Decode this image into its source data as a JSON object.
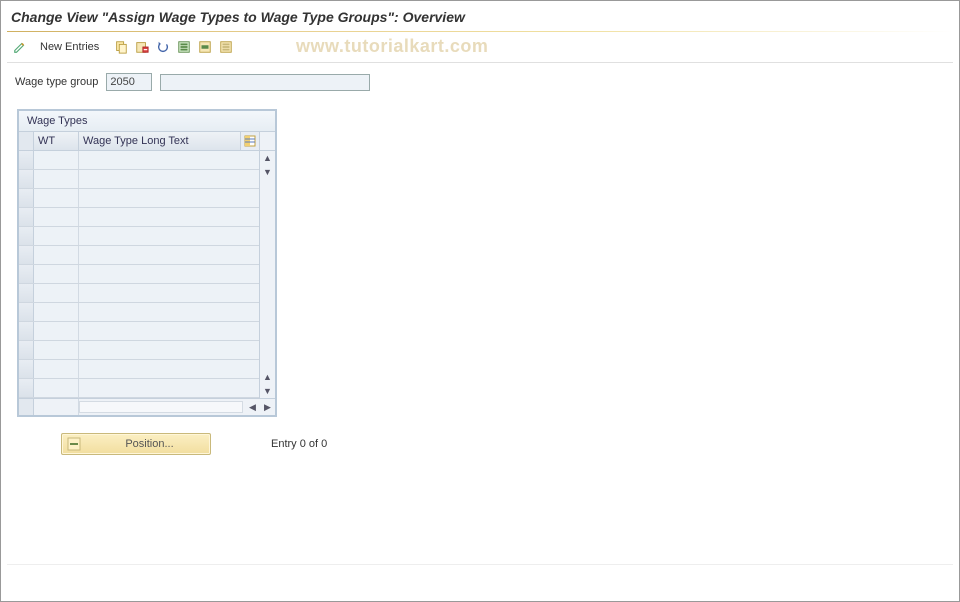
{
  "header": {
    "title": "Change View \"Assign Wage Types to Wage Type Groups\": Overview"
  },
  "toolbar": {
    "new_entries_label": "New Entries"
  },
  "watermark": "www.tutorialkart.com",
  "filter": {
    "label": "Wage type group",
    "value": "2050",
    "description": ""
  },
  "table": {
    "title": "Wage Types",
    "columns": {
      "wt": "WT",
      "long_text": "Wage Type Long Text"
    },
    "rows": [
      {
        "wt": "",
        "text": ""
      },
      {
        "wt": "",
        "text": ""
      },
      {
        "wt": "",
        "text": ""
      },
      {
        "wt": "",
        "text": ""
      },
      {
        "wt": "",
        "text": ""
      },
      {
        "wt": "",
        "text": ""
      },
      {
        "wt": "",
        "text": ""
      },
      {
        "wt": "",
        "text": ""
      },
      {
        "wt": "",
        "text": ""
      },
      {
        "wt": "",
        "text": ""
      },
      {
        "wt": "",
        "text": ""
      },
      {
        "wt": "",
        "text": ""
      },
      {
        "wt": "",
        "text": ""
      }
    ]
  },
  "footer": {
    "position_label": "Position...",
    "entry_text": "Entry 0 of 0"
  },
  "icons": {
    "toggle": "toggle-display-change",
    "copy": "copy",
    "delete": "delete",
    "undo": "undo",
    "select_all": "select-all",
    "select_block": "select-block",
    "deselect_all": "deselect-all",
    "config": "table-settings",
    "position": "position"
  }
}
